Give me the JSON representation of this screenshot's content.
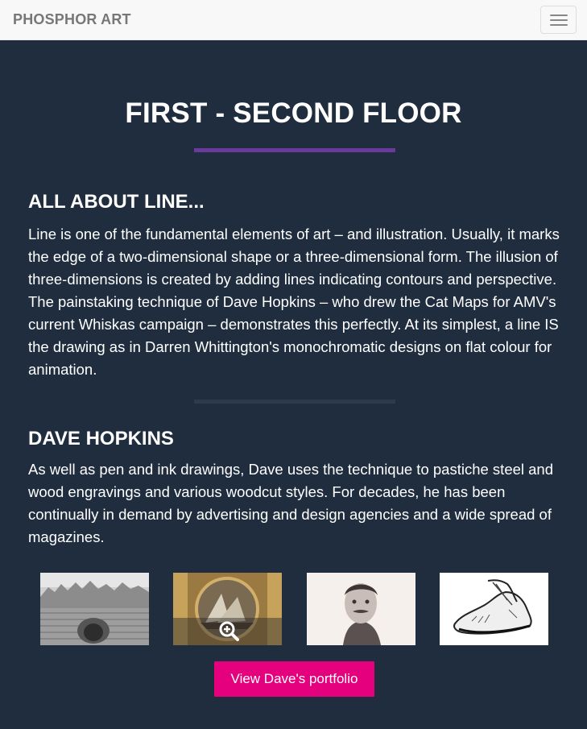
{
  "navbar": {
    "brand": "PHOSPHOR ART",
    "toggle_icon": "hamburger-menu-icon"
  },
  "page": {
    "title": "FIRST - SECOND FLOOR"
  },
  "sections": [
    {
      "heading": "ALL ABOUT LINE...",
      "text": "Line is one of the fundamental elements of art – and illustration. Usually, it marks the edge of a two-dimensional shape or a three-dimensional form. The illusion of three-dimensions is created by adding lines indicating contours and perspective. The painstaking technique of Dave Hopkins – who drew the Cat Maps for AMV's current Whiskas campaign – demonstrates this perfectly. At its simplest, a line IS the drawing as in Darren Whittington's monochromatic designs on flat colour for animation."
    },
    {
      "heading": "DAVE HOPKINS",
      "text": "As well as pen and ink drawings, Dave uses the technique to pastiche steel and wood engravings and various woodcut styles. For decades, he has been continually in demand by advertising and design agencies and a wide spread of magazines."
    }
  ],
  "gallery": {
    "zoom_icon": "zoom-in-icon"
  },
  "cta": {
    "label": "View Dave's portfolio"
  },
  "colors": {
    "background": "#1f2d3f",
    "accent_purple": "#6a3a9c",
    "button_pink": "#e5007e",
    "navbar_bg": "#f8f8f8"
  }
}
